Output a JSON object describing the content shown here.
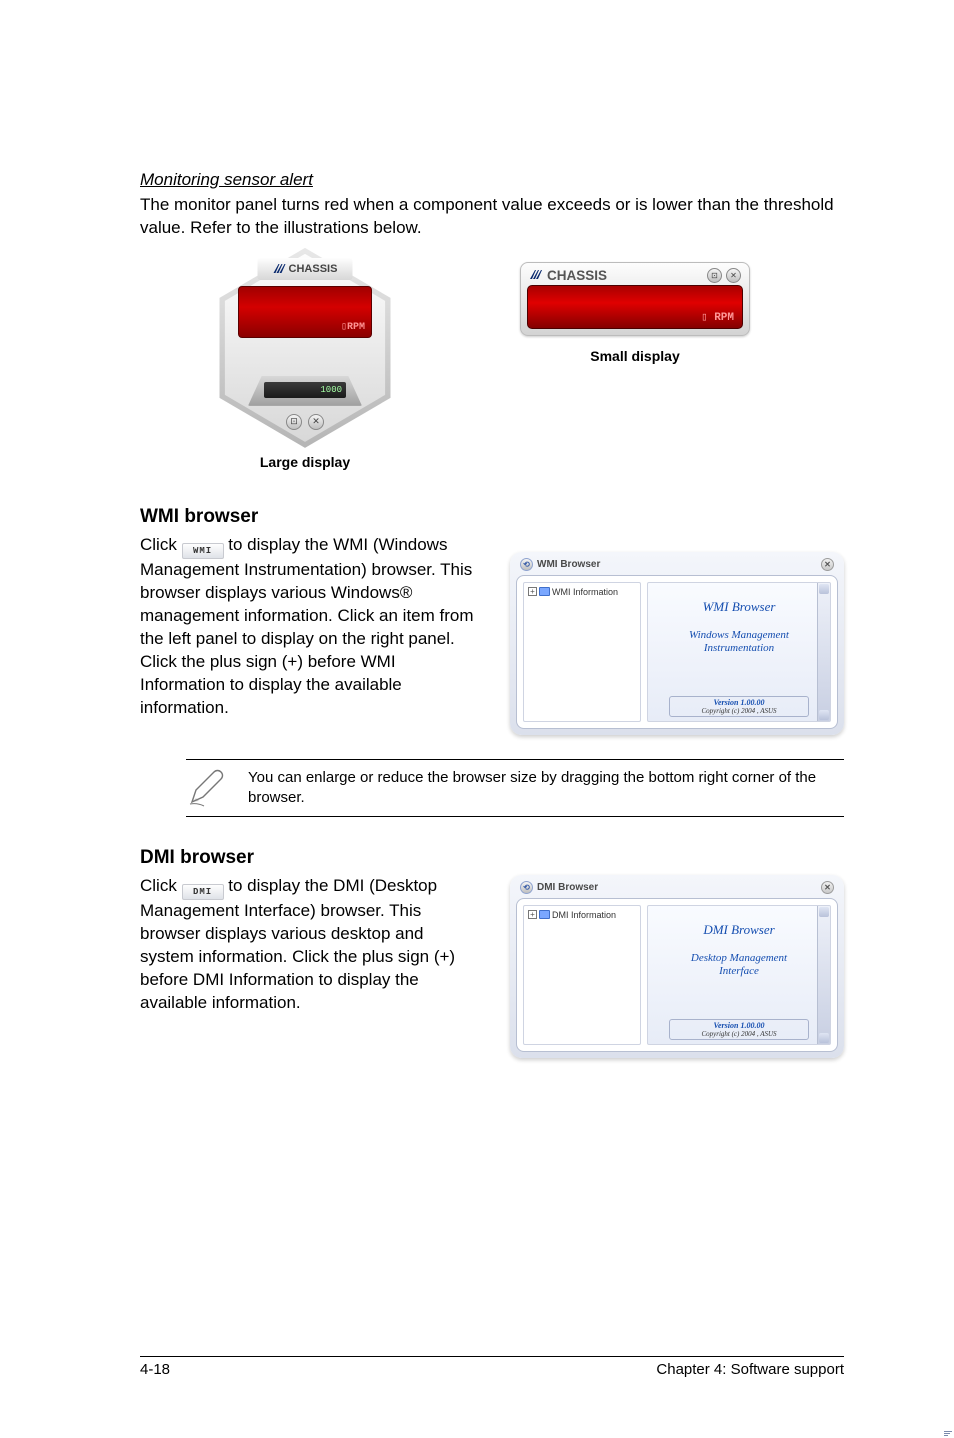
{
  "sensor_alert": {
    "heading": "Monitoring sensor alert",
    "body": "The monitor panel turns red when a component value exceeds or is lower than the threshold value. Refer to the illustrations below.",
    "large_caption": "Large display",
    "small_caption": "Small display",
    "chassis_label": "CHASSIS",
    "rpm_label": "RPM",
    "hex_lcd": "1000"
  },
  "wmi": {
    "title": "WMI browser",
    "body_pre": "Click ",
    "button_label": "WMI",
    "body_post": " to display the WMI (Windows Management Instrumentation) browser. This browser displays various Windows® management information. Click an item from the left panel to display on the right panel. Click the plus sign (+) before WMI Information to display the available information.",
    "window": {
      "win_title": "WMI Browser",
      "tree_root": "WMI Information",
      "content_title": "WMI  Browser",
      "content_sub": "Windows Management Instrumentation",
      "version": "Version 1.00.00",
      "copyright": "Copyright (c) 2004 , ASUS"
    }
  },
  "note": {
    "text": "You can enlarge or reduce the browser size by dragging the bottom right corner of the browser."
  },
  "dmi": {
    "title": "DMI browser",
    "body_pre": "Click ",
    "button_label": "DMI",
    "body_post": " to display the DMI (Desktop Management Interface) browser. This browser displays various desktop and system information. Click the plus sign (+) before DMI Information to display the available information.",
    "window": {
      "win_title": "DMI Browser",
      "tree_root": "DMI Information",
      "content_title": "DMI  Browser",
      "content_sub": "Desktop Management Interface",
      "version": "Version 1.00.00",
      "copyright": "Copyright (c) 2004 , ASUS"
    }
  },
  "footer": {
    "left": "4-18",
    "right": "Chapter 4: Software support"
  }
}
